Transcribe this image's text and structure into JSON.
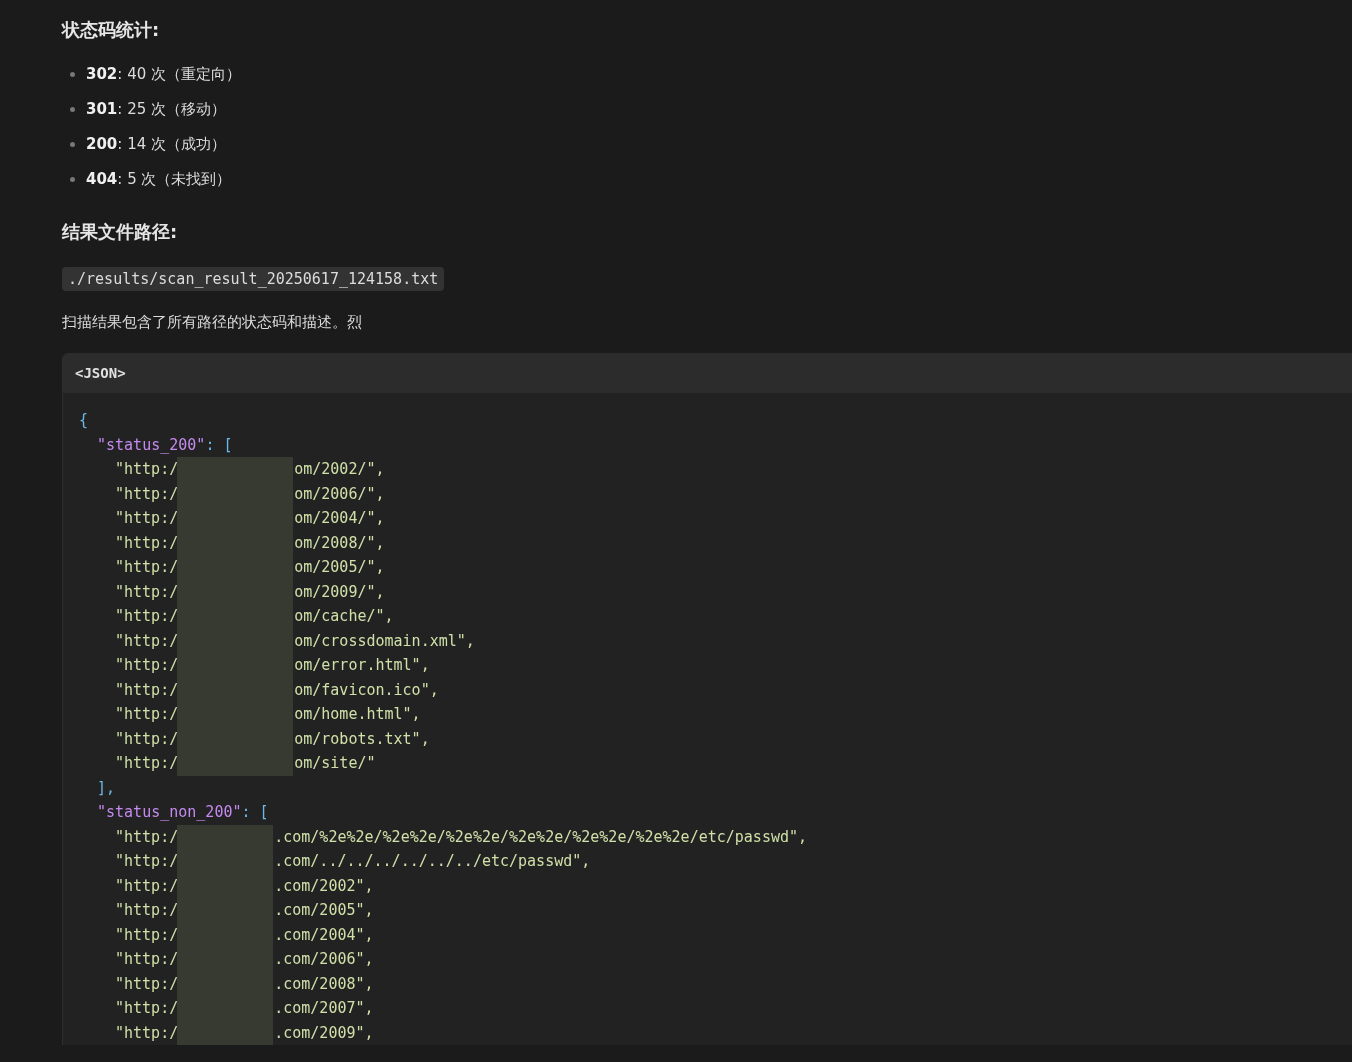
{
  "stats_heading": "状态码统计:",
  "stats": [
    {
      "code": "302",
      "text": ": 40 次（重定向）"
    },
    {
      "code": "301",
      "text": ": 25 次（移动）"
    },
    {
      "code": "200",
      "text": ": 14 次（成功）"
    },
    {
      "code": "404",
      "text": ": 5 次（未找到）"
    }
  ],
  "path_heading": "结果文件路径:",
  "path": "./results/scan_result_20250617_124158.txt",
  "note": "扫描结果包含了所有路径的状态码和描述。烈",
  "code_block": {
    "language": "<JSON>",
    "open": "{",
    "groups": [
      {
        "key": "\"status_200\"",
        "punct": ": [",
        "close": "],",
        "items": [
          {
            "prefix": "\"http:/",
            "suffix": "om/2002/\","
          },
          {
            "prefix": "\"http:/",
            "suffix": "om/2006/\","
          },
          {
            "prefix": "\"http:/",
            "suffix": "om/2004/\","
          },
          {
            "prefix": "\"http:/",
            "suffix": "om/2008/\","
          },
          {
            "prefix": "\"http:/",
            "suffix": "om/2005/\","
          },
          {
            "prefix": "\"http:/",
            "suffix": "om/2009/\","
          },
          {
            "prefix": "\"http:/",
            "suffix": "om/cache/\","
          },
          {
            "prefix": "\"http:/",
            "suffix": "om/crossdomain.xml\","
          },
          {
            "prefix": "\"http:/",
            "suffix": "om/error.html\","
          },
          {
            "prefix": "\"http:/",
            "suffix": "om/favicon.ico\","
          },
          {
            "prefix": "\"http:/",
            "suffix": "om/home.html\","
          },
          {
            "prefix": "\"http:/",
            "suffix": "om/robots.txt\","
          },
          {
            "prefix": "\"http:/",
            "suffix": "om/site/\""
          }
        ]
      },
      {
        "key": "\"status_non_200\"",
        "punct": ": [",
        "items": [
          {
            "prefix": "\"http:/",
            "suffix": ".com/%2e%2e/%2e%2e/%2e%2e/%2e%2e/%2e%2e/%2e%2e/etc/passwd\","
          },
          {
            "prefix": "\"http:/",
            "suffix": ".com/../../../../../../etc/passwd\","
          },
          {
            "prefix": "\"http:/",
            "suffix": ".com/2002\","
          },
          {
            "prefix": "\"http:/",
            "suffix": ".com/2005\","
          },
          {
            "prefix": "\"http:/",
            "suffix": ".com/2004\","
          },
          {
            "prefix": "\"http:/",
            "suffix": ".com/2006\","
          },
          {
            "prefix": "\"http:/",
            "suffix": ".com/2008\","
          },
          {
            "prefix": "\"http:/",
            "suffix": ".com/2007\","
          },
          {
            "prefix": "\"http:/",
            "suffix": ".com/2009\","
          }
        ]
      }
    ]
  }
}
